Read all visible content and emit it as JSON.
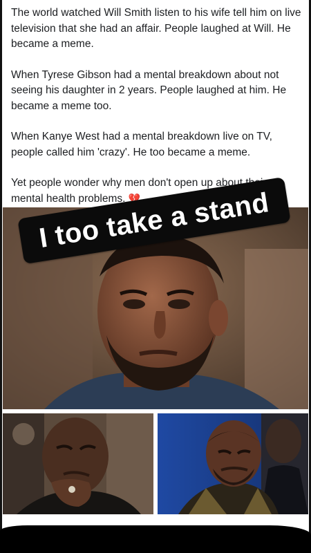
{
  "post": {
    "paragraphs": [
      "The world watched Will Smith listen to his wife tell him on live television that she had an affair. People laughed at Will. He became a meme.",
      "When Tyrese Gibson had a mental breakdown about not seeing his daughter in 2 years. People laughed at him. He became a meme too.",
      "When Kanye West had a mental breakdown live on TV, people called him 'crazy'. He too became a meme."
    ],
    "last_paragraph": "Yet people wonder why men don't open up about their mental health problems.",
    "emoji": "💔"
  },
  "sticker": {
    "text": "I too take a stand"
  },
  "colors": {
    "text": "#1c1e21",
    "sticker_bg": "#0b0b0b",
    "sticker_text": "#ffffff"
  }
}
